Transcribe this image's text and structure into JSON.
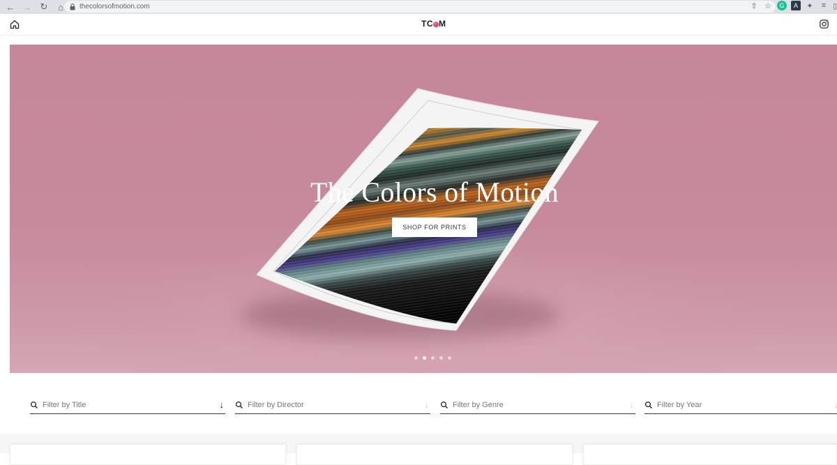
{
  "browser": {
    "url": "thecolorsofmotion.com",
    "icons": [
      "back-icon",
      "forward-icon",
      "reload-icon",
      "home-icon",
      "lock-icon",
      "share-icon",
      "star-icon",
      "grammarly-icon",
      "extension-a-icon",
      "puzzle-icon",
      "reading-list-icon"
    ]
  },
  "header": {
    "logo_prefix": "TC",
    "logo_suffix": "M"
  },
  "hero": {
    "title": "The Colors of Motion",
    "cta_label": "SHOP FOR PRINTS",
    "slide_count": 5,
    "active_slide": 2,
    "background_color": "#c58799"
  },
  "filters": [
    {
      "placeholder": "Filter by Title"
    },
    {
      "placeholder": "Filter by Director"
    },
    {
      "placeholder": "Filter by Genre"
    },
    {
      "placeholder": "Filter by Year"
    }
  ],
  "colors": {
    "accent_pink": "#c2185b",
    "hero_pink": "#c58799"
  }
}
